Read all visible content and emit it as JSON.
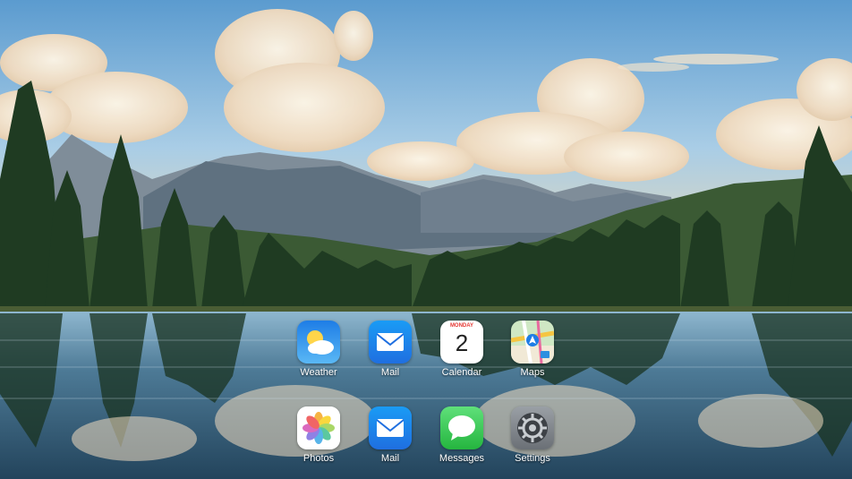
{
  "wallpaper": {
    "description_icon": "mountain-lake-wallpaper",
    "sky_color": "#6fa9d6",
    "water_color": "#2c4f6b"
  },
  "home_screen": {
    "apps": [
      {
        "label": "Weather",
        "icon": "weather-icon"
      },
      {
        "label": "Mail",
        "icon": "mail-icon"
      },
      {
        "label": "Calendar",
        "icon": "calendar-icon",
        "day": "MONDAY",
        "date": "2"
      },
      {
        "label": "Maps",
        "icon": "maps-icon"
      },
      {
        "label": "Photos",
        "icon": "photos-icon"
      },
      {
        "label": "Mail",
        "icon": "mail-icon"
      },
      {
        "label": "Messages",
        "icon": "messages-icon"
      },
      {
        "label": "Settings",
        "icon": "settings-icon"
      }
    ]
  }
}
